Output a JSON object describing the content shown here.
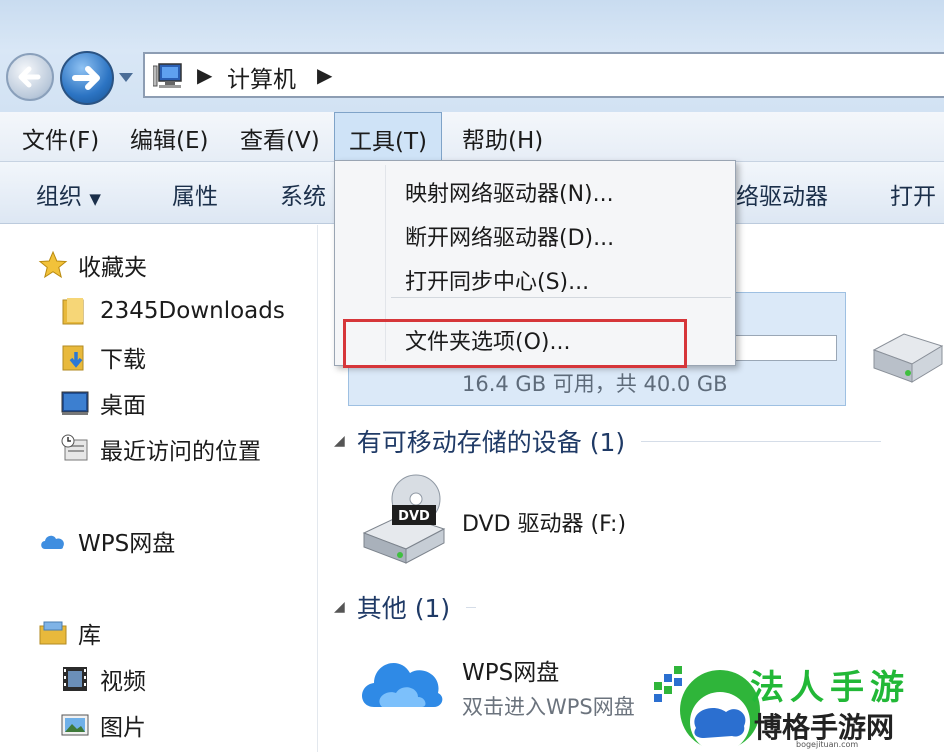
{
  "address": {
    "crumb": "计算机"
  },
  "menubar": {
    "items": [
      "文件(F)",
      "编辑(E)",
      "查看(V)",
      "工具(T)",
      "帮助(H)"
    ],
    "active": "工具(T)"
  },
  "commandbar": {
    "organize": "组织",
    "properties": "属性",
    "system_partial": "系统",
    "map_drive_partial": "络驱动器",
    "open_partial": "打开"
  },
  "navpane": {
    "favorites": "收藏夹",
    "downloads_2345": "2345Downloads",
    "downloads": "下载",
    "desktop": "桌面",
    "recent": "最近访问的位置",
    "wps": "WPS网盘",
    "libraries": "库",
    "videos": "视频",
    "pictures": "图片"
  },
  "content": {
    "drive_free": "16.4 GB 可用，共 40.0 GB",
    "removable_section": "有可移动存储的设备 (1)",
    "dvd_label": "DVD 驱动器 (F:)",
    "dvd_badge": "DVD",
    "other_section": "其他 (1)",
    "wps_title": "WPS网盘",
    "wps_desc": "双击进入WPS网盘"
  },
  "tools_menu": {
    "items": [
      "映射网络驱动器(N)...",
      "断开网络驱动器(D)...",
      "打开同步中心(S)...",
      "文件夹选项(O)..."
    ],
    "highlighted": "文件夹选项(O)..."
  },
  "watermark": {
    "title": "法人手游",
    "main": "博格手游网",
    "url": "bogejituan.com"
  },
  "colors": {
    "highlight_box": "#d6363a",
    "menu_active": "#cfe3f7",
    "section_title": "#1f3a66",
    "watermark_green": "#22b837"
  }
}
